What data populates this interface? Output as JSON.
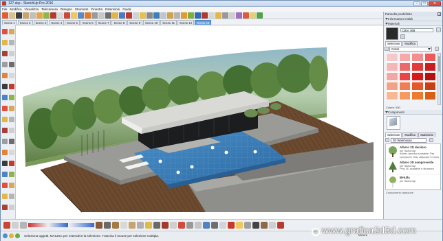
{
  "window": {
    "title": "127.skp - SketchUp Pro 2016"
  },
  "menu": [
    "File",
    "Modifica",
    "Visualizza",
    "Telecamera",
    "Disegno",
    "Strumenti",
    "Finestra",
    "Estensioni",
    "Guida"
  ],
  "scenes": {
    "tabs": [
      "Scene 1",
      "Scene 2",
      "Scene 3",
      "Scene 4",
      "Scene 5",
      "Scene 6",
      "Scene 7",
      "Scene 8",
      "Scene 9",
      "Scene 10",
      "Scene 11",
      "Scene 12",
      "Scene 13"
    ],
    "active_index": 12
  },
  "tray": {
    "title": "Pannello predefinito",
    "sections": {
      "entity_info": "Informazioni entità",
      "materials": "Materiali",
      "components": "Componenti"
    },
    "material_name": "Color_009",
    "material_tabs": [
      "Selezione",
      "Modifica"
    ],
    "library_selected": "Colori",
    "status_text": "Colore: 000",
    "component_tabs": [
      "Selezione",
      "Modifica",
      "Statistiche"
    ],
    "component_search": "3D Warehouse",
    "components_list": [
      {
        "title": "Albero 2D deciduo",
        "by": "per SketchUp",
        "desc": "Albero deciduo scalabile. Per conoscere l'età, utilizzare il menu"
      },
      {
        "title": "Albero 3D sempreverde",
        "by": "per SketchUp",
        "desc": "Pino 3D scalabile e dinamico"
      },
      {
        "title": "Betulla",
        "by": "per SketchUp",
        "desc": ""
      }
    ],
    "components_footer": "Componenti campione",
    "palette": [
      "#f6c9c9",
      "#f7a9a9",
      "#f58e8e",
      "#ee5a5a",
      "#f4b7b7",
      "#e86a6a",
      "#e03a3a",
      "#c81e1e",
      "#f2a7a7",
      "#e94545",
      "#d61919",
      "#b31010",
      "#f3a28a",
      "#ef7d57",
      "#e4582b",
      "#c73f16",
      "#f8b894",
      "#f59b62",
      "#ee7a2f",
      "#d85f14"
    ]
  },
  "status": {
    "message": "Seleziona oggetti. MAIUSC per estendere la selezione. Trascina il mouse per selezione multipla.",
    "measurements_label": "Misure"
  },
  "watermark": "www.grafica2d3d.com",
  "colors": {
    "accent": "#6aa2e0",
    "wood": "#6b4a2f",
    "water": "#3f7fb8",
    "concrete": "#9a9a96"
  }
}
